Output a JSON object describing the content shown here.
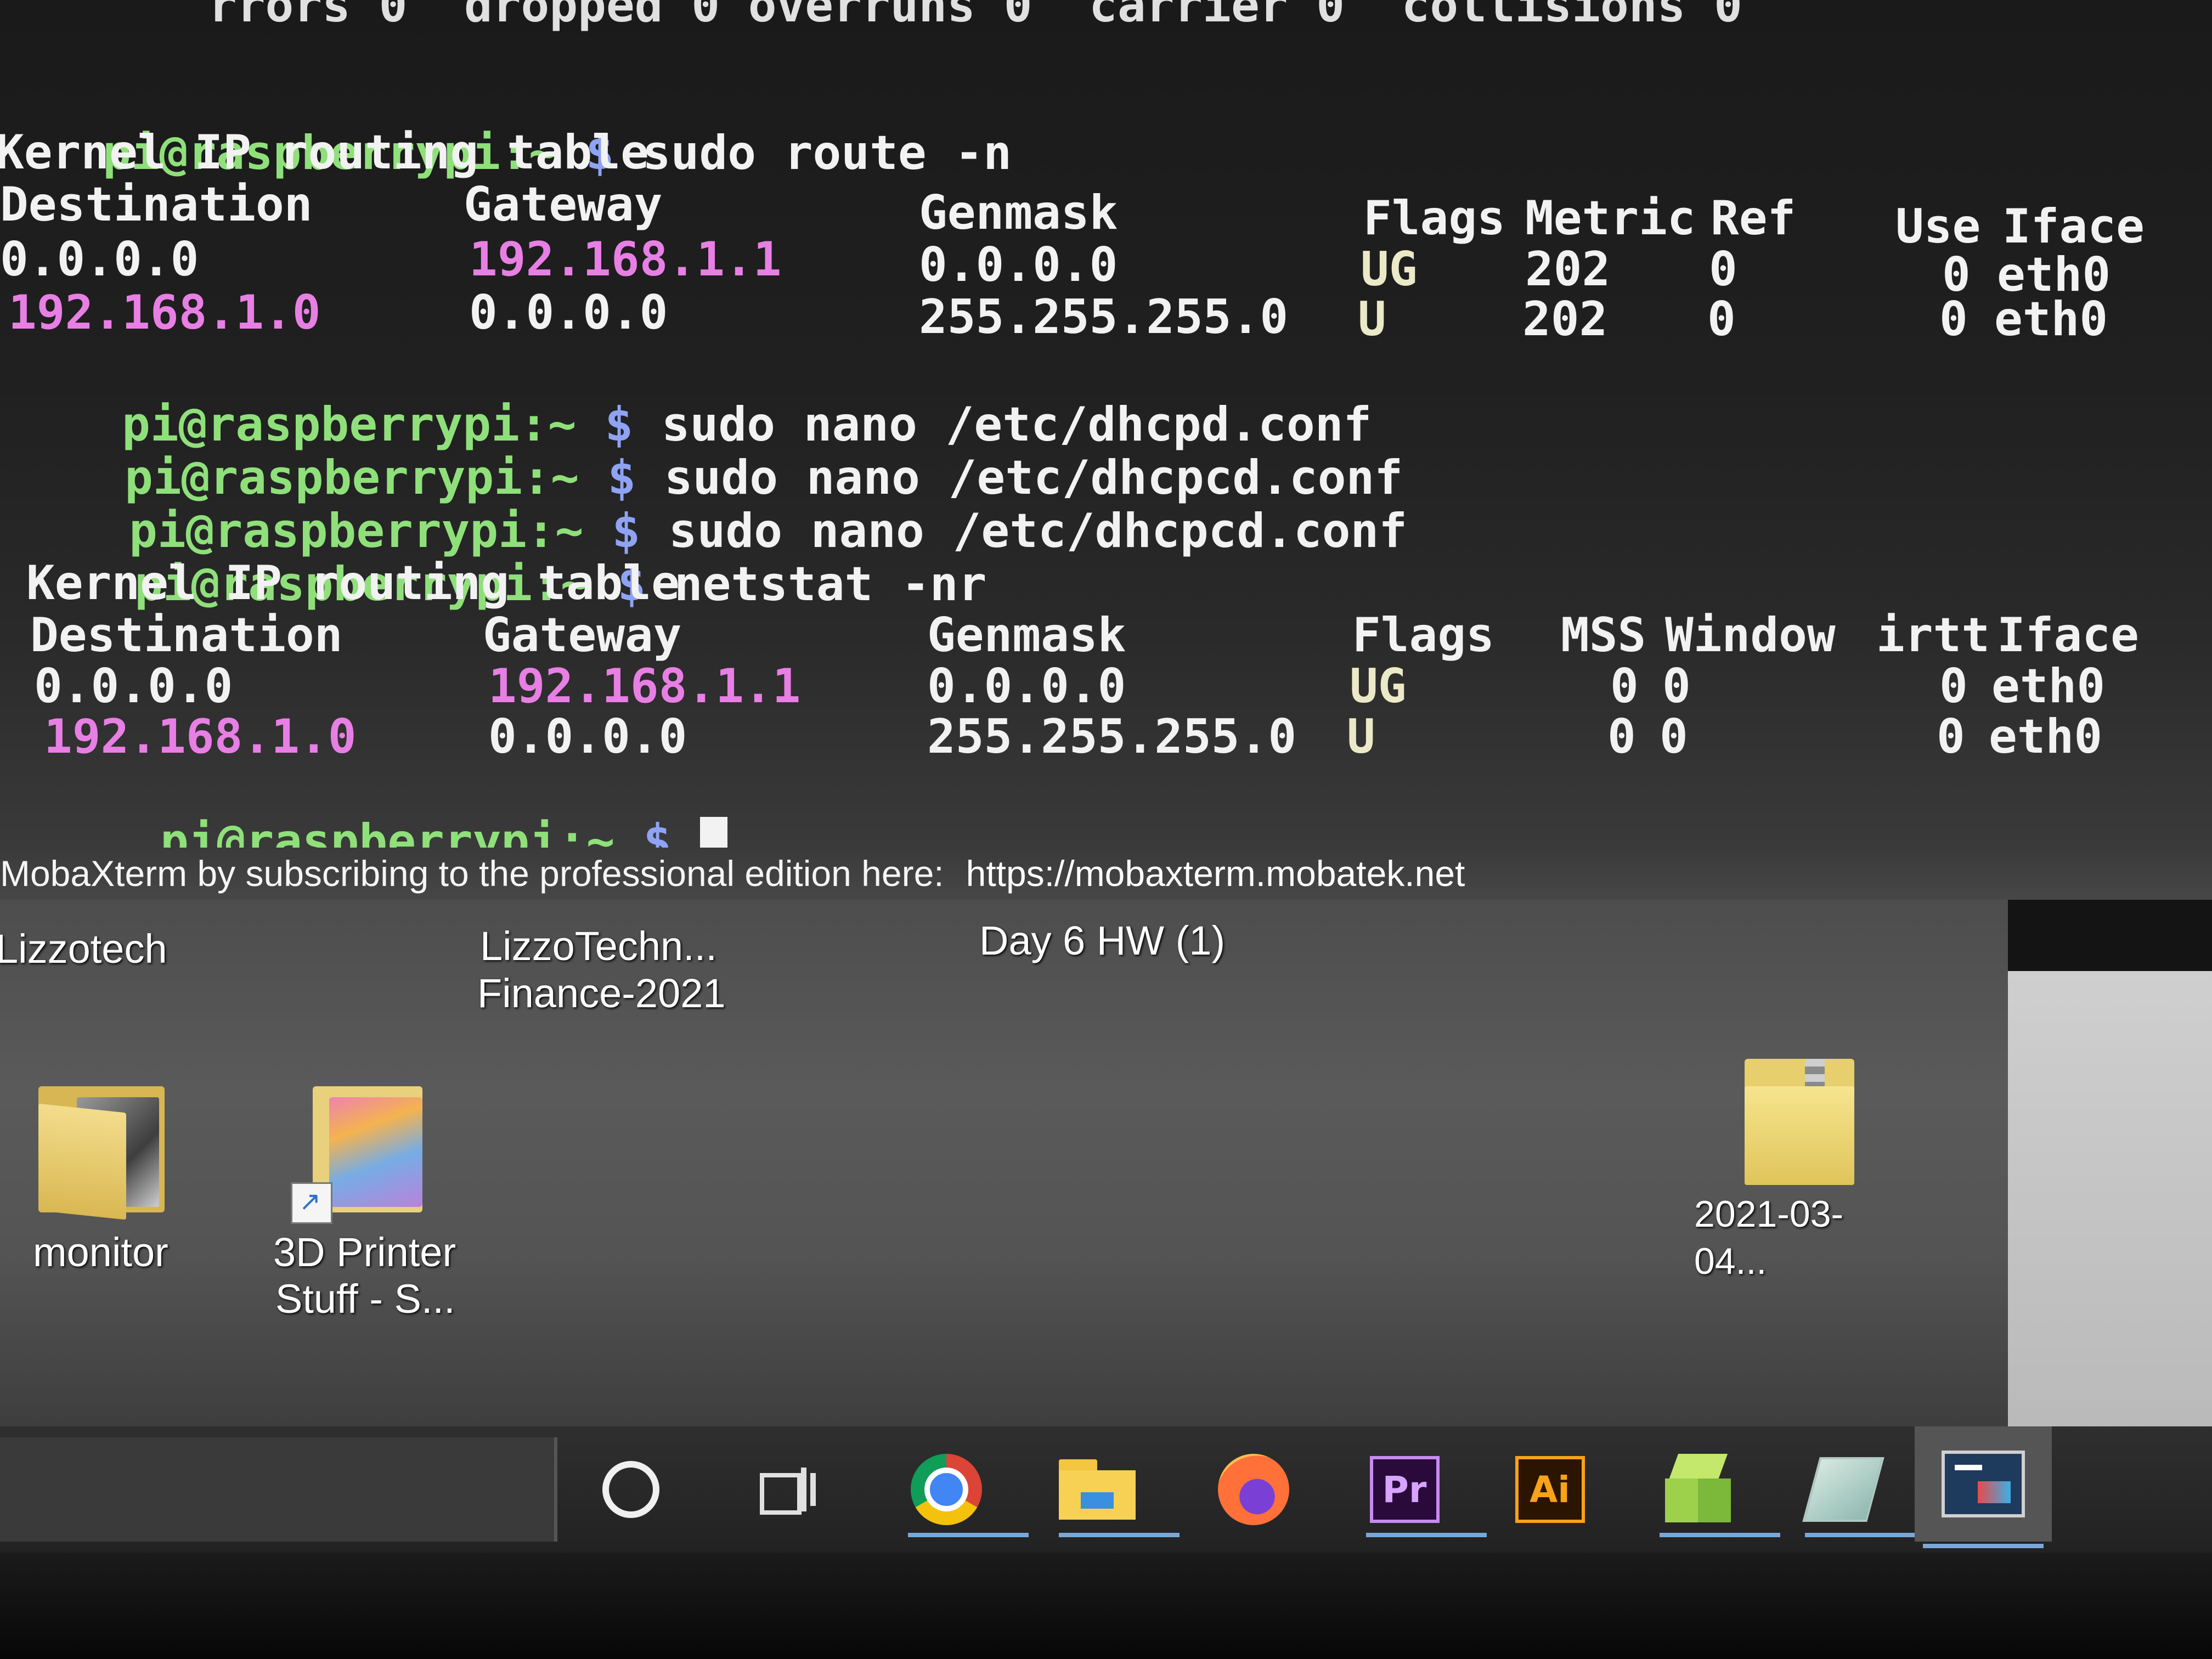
{
  "terminal": {
    "top_line": "rrors 0  dropped 0 overruns 0  carrier 0  collisions 0",
    "prompt": "pi@raspberrypi:~",
    "dollar": "$",
    "cmd1": "sudo route -n",
    "table_title": "Kernel IP routing table",
    "route_headers": [
      "Destination",
      "Gateway",
      "Genmask",
      "Flags",
      "Metric",
      "Ref",
      "Use",
      "Iface"
    ],
    "route_rows": [
      {
        "dest": "0.0.0.0",
        "gw": "192.168.1.1",
        "mask": "0.0.0.0",
        "flags": "UG",
        "metric": "202",
        "ref": "0",
        "use": "0",
        "iface": "eth0"
      },
      {
        "dest": "192.168.1.0",
        "gw": "0.0.0.0",
        "mask": "255.255.255.0",
        "flags": "U",
        "metric": "202",
        "ref": "0",
        "use": "0",
        "iface": "eth0"
      }
    ],
    "cmd2": "sudo nano /etc/dhcpd.conf",
    "cmd3": "sudo nano /etc/dhcpcd.conf",
    "cmd4": "sudo nano /etc/dhcpcd.conf",
    "cmd5": "netstat -nr",
    "netstat_headers": [
      "Destination",
      "Gateway",
      "Genmask",
      "Flags",
      "MSS",
      "Window",
      "irtt",
      "Iface"
    ],
    "netstat_rows": [
      {
        "dest": "0.0.0.0",
        "gw": "192.168.1.1",
        "mask": "0.0.0.0",
        "flags": "UG",
        "mss": "0",
        "window": "0",
        "irtt": "0",
        "iface": "eth0"
      },
      {
        "dest": "192.168.1.0",
        "gw": "0.0.0.0",
        "mask": "255.255.255.0",
        "flags": "U",
        "mss": "0",
        "window": "0",
        "irtt": "0",
        "iface": "eth0"
      }
    ]
  },
  "banner": {
    "text": "MobaXterm by subscribing to the professional edition here:",
    "link": "https://mobaxterm.mobatek.net"
  },
  "desktop": {
    "top_labels": [
      {
        "text": "Lizzotech"
      },
      {
        "text": "LizzoTechn..."
      },
      {
        "text": "Finance-2021"
      },
      {
        "text": "Day 6 HW (1)"
      }
    ],
    "icons": [
      {
        "label": "monitor",
        "icon": "folder-icon"
      },
      {
        "label_line1": "3D Printer",
        "label_line2": "Stuff - S...",
        "icon": "shortcut-folder-icon"
      },
      {
        "label": "2021-03-04...",
        "icon": "zip-folder-icon"
      }
    ]
  },
  "taskbar": {
    "items": [
      "cortana-search",
      "task-view",
      "chrome",
      "file-explorer",
      "firefox",
      "premiere-pro",
      "illustrator",
      "3d-builder",
      "sticky-app",
      "mobaxterm"
    ],
    "premiere_label": "Pr",
    "illustrator_label": "Ai"
  }
}
